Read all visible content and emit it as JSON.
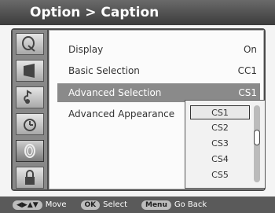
{
  "header": {
    "title": "Option > Caption"
  },
  "sidebar": {
    "items": [
      {
        "icon": "satellite-dish-icon"
      },
      {
        "icon": "display-panel-icon"
      },
      {
        "icon": "audio-icon"
      },
      {
        "icon": "clock-icon"
      },
      {
        "icon": "caption-option-icon"
      },
      {
        "icon": "lock-icon"
      }
    ]
  },
  "menu": {
    "rows": [
      {
        "label": "Display",
        "value": "On"
      },
      {
        "label": "Basic Selection",
        "value": "CC1"
      },
      {
        "label": "Advanced Selection",
        "value": "CS1"
      },
      {
        "label": "Advanced Appearance",
        "value": ""
      }
    ],
    "selected_index": 2
  },
  "dropdown": {
    "options": [
      "CS1",
      "CS2",
      "CS3",
      "CS4",
      "CS5"
    ],
    "selected": "CS1"
  },
  "footer": {
    "move_key": "◀▶▲▼",
    "move_label": "Move",
    "ok_key": "OK",
    "ok_label": "Select",
    "menu_key": "Menu",
    "menu_label": "Go Back"
  }
}
